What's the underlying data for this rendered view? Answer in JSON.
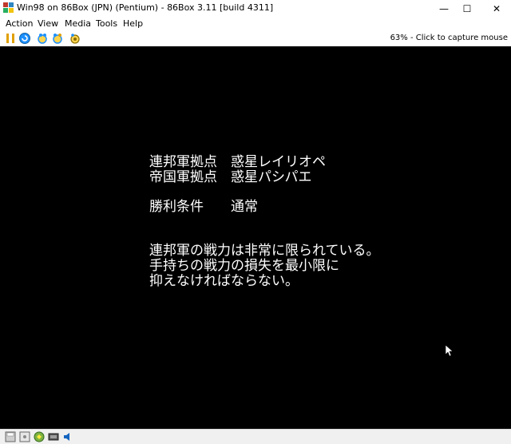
{
  "window": {
    "title": "Win98 on 86Box (JPN) (Pentium) - 86Box 3.11 [build 4311]",
    "minimize": "—",
    "maximize": "☐",
    "close": "✕"
  },
  "menu": [
    "Action",
    "View",
    "Media",
    "Tools",
    "Help"
  ],
  "toolbar": {
    "icons": [
      "pause-icon",
      "ctrl-alt-del-icon",
      "reset-icon",
      "hard-reset-icon",
      "settings-icon"
    ],
    "capture_hint": "63% - Click to capture mouse"
  },
  "screen": {
    "lines": {
      "base1": "連邦軍拠点　惑星レイリオペ",
      "base2": "帝国軍拠点　惑星パシパエ",
      "victory": "勝利条件　　通常",
      "msg1": "連邦軍の戦力は非常に限られている。",
      "msg2": "手持ちの戦力の損失を最小限に",
      "msg3": "抑えなければならない。"
    }
  },
  "statusbar": {
    "icons": [
      "floppy-drive-icon",
      "cdrom-drive-icon",
      "hard-disk-icon",
      "network-icon",
      "sound-icon"
    ]
  },
  "colors": {
    "screen_bg": "#000000",
    "screen_text": "#ffffff",
    "pause_icon": "#e0a000",
    "reset_icon": "#1e90ff"
  }
}
